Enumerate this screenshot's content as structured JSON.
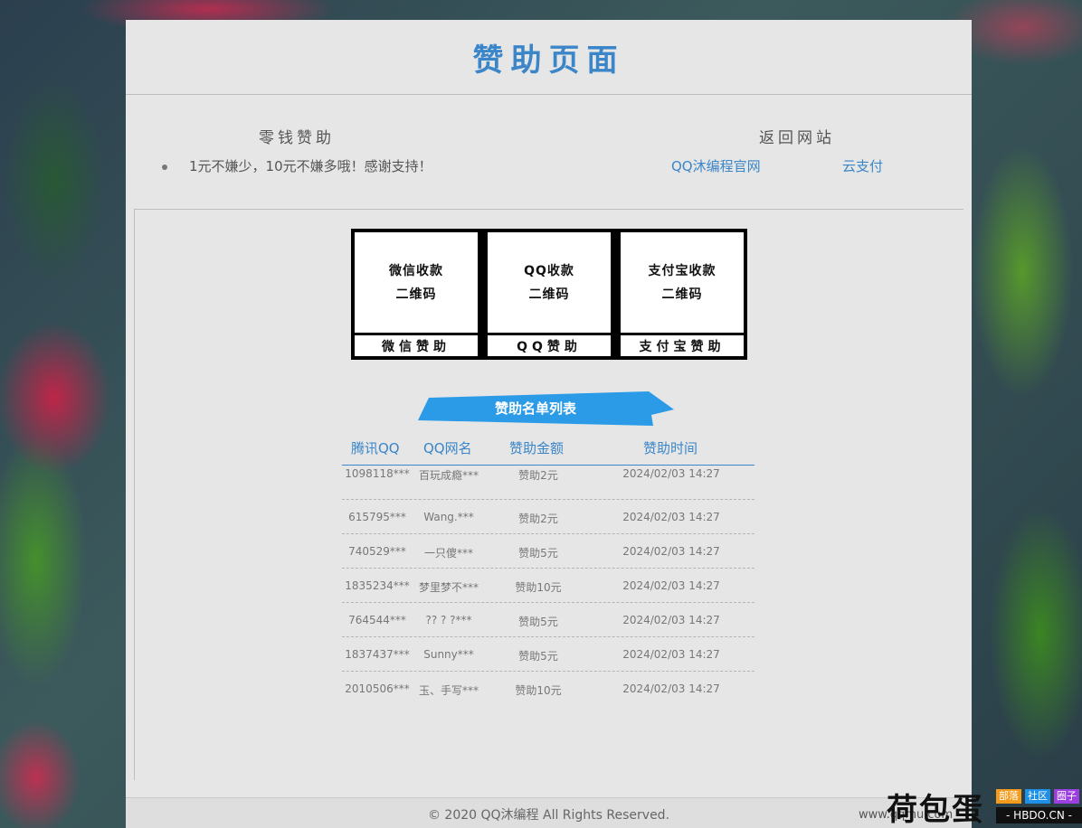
{
  "header": {
    "title": "赞助页面"
  },
  "info": {
    "donate_heading": "零钱赞助",
    "donate_note": "1元不嫌少，10元不嫌多哦！感谢支持！",
    "return_heading": "返回网站",
    "links": [
      "QQ沐编程官网",
      "云支付"
    ]
  },
  "qrcodes": [
    {
      "line1": "微信收款",
      "line2": "二维码",
      "caption": "微信赞助"
    },
    {
      "line1": "QQ收款",
      "line2": "二维码",
      "caption": "QQ赞助"
    },
    {
      "line1": "支付宝收款",
      "line2": "二维码",
      "caption": "支付宝赞助"
    }
  ],
  "sponsor_list": {
    "banner": "赞助名单列表",
    "headers": [
      "腾讯QQ",
      "QQ网名",
      "赞助金额",
      "赞助时间"
    ],
    "rows": [
      [
        "1098118***",
        "百玩成瘾***",
        "赞助2元",
        "2024/02/03 14:27"
      ],
      [
        "615795***",
        "Wang.***",
        "赞助2元",
        "2024/02/03 14:27"
      ],
      [
        "740529***",
        "一只傻***",
        "赞助5元",
        "2024/02/03 14:27"
      ],
      [
        "1835234***",
        "梦里梦不***",
        "赞助10元",
        "2024/02/03 14:27"
      ],
      [
        "764544***",
        "?? ? ?***",
        "赞助5元",
        "2024/02/03 14:27"
      ],
      [
        "1837437***",
        "Sunny***",
        "赞助5元",
        "2024/02/03 14:27"
      ],
      [
        "2010506***",
        "玉、手写***",
        "赞助10元",
        "2024/02/03 14:27"
      ]
    ]
  },
  "footer": {
    "copyright": "© 2020 QQ沐编程 All Rights Reserved."
  },
  "watermark": {
    "brand": "荷包蛋",
    "tags": [
      "部落",
      "社区",
      "圈子"
    ],
    "domain": "- HBDO.CN -",
    "faint_text": "www.qqmu.com"
  },
  "colors": {
    "accent": "#3a86c8",
    "ribbon": "#2b9be8"
  }
}
